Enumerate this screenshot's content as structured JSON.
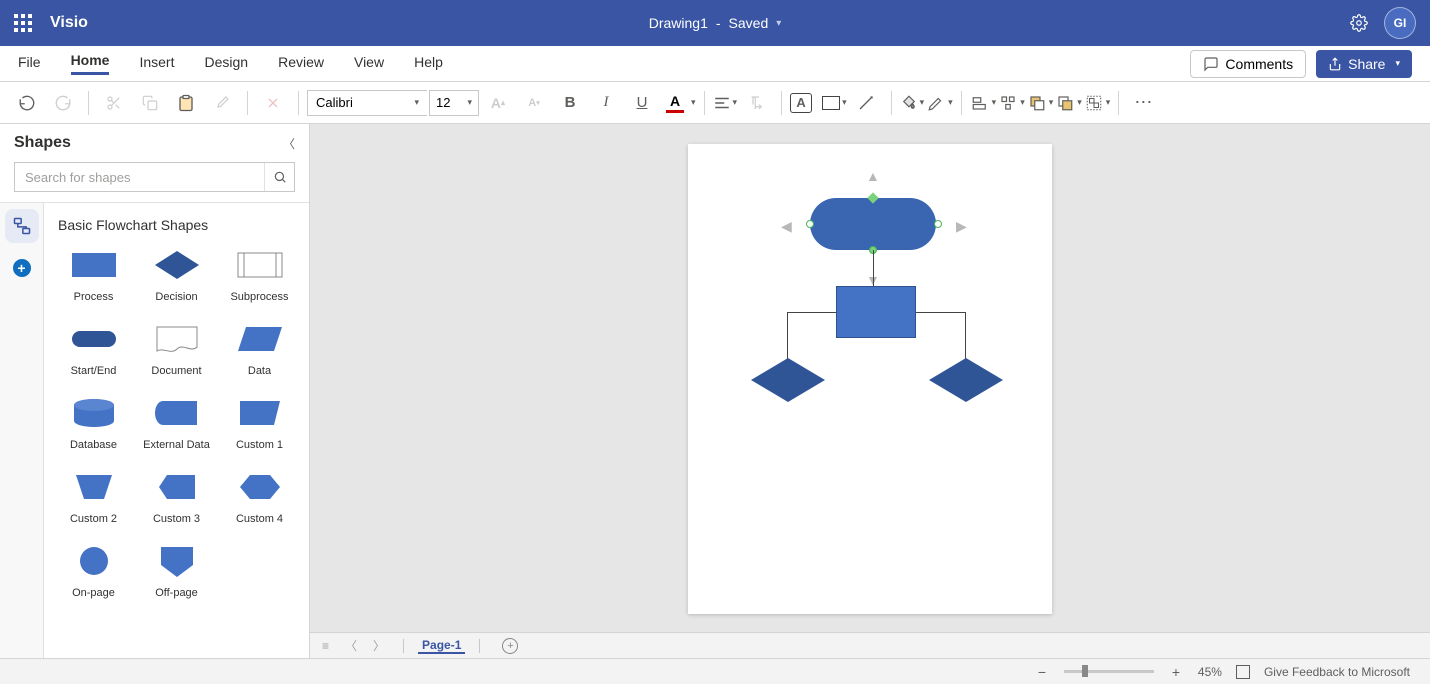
{
  "app": {
    "name": "Visio"
  },
  "document": {
    "name": "Drawing1",
    "status": "Saved",
    "separator": "  -  "
  },
  "user": {
    "initials": "GI"
  },
  "tabs": {
    "file": "File",
    "home": "Home",
    "insert": "Insert",
    "design": "Design",
    "review": "Review",
    "view": "View",
    "help": "Help"
  },
  "actions": {
    "comments": "Comments",
    "share": "Share"
  },
  "toolbar": {
    "font_name": "Calibri",
    "font_size": "12"
  },
  "shapes_panel": {
    "title": "Shapes",
    "search_placeholder": "Search for shapes",
    "stencil_title": "Basic Flowchart Shapes",
    "items": [
      {
        "label": "Process",
        "kind": "process"
      },
      {
        "label": "Decision",
        "kind": "decision"
      },
      {
        "label": "Subprocess",
        "kind": "subprocess"
      },
      {
        "label": "Start/End",
        "kind": "terminator"
      },
      {
        "label": "Document",
        "kind": "document"
      },
      {
        "label": "Data",
        "kind": "data"
      },
      {
        "label": "Database",
        "kind": "database"
      },
      {
        "label": "External Data",
        "kind": "extdata"
      },
      {
        "label": "Custom 1",
        "kind": "custom1"
      },
      {
        "label": "Custom 2",
        "kind": "custom2"
      },
      {
        "label": "Custom 3",
        "kind": "custom3"
      },
      {
        "label": "Custom 4",
        "kind": "custom4"
      },
      {
        "label": "On-page",
        "kind": "onpage"
      },
      {
        "label": "Off-page",
        "kind": "offpage"
      }
    ]
  },
  "pages": {
    "current": "Page-1"
  },
  "status": {
    "zoom": "45%",
    "feedback": "Give Feedback to Microsoft"
  },
  "colors": {
    "brand": "#3955a3",
    "shape_fill": "#4472c4",
    "shape_dark": "#2f5597"
  }
}
